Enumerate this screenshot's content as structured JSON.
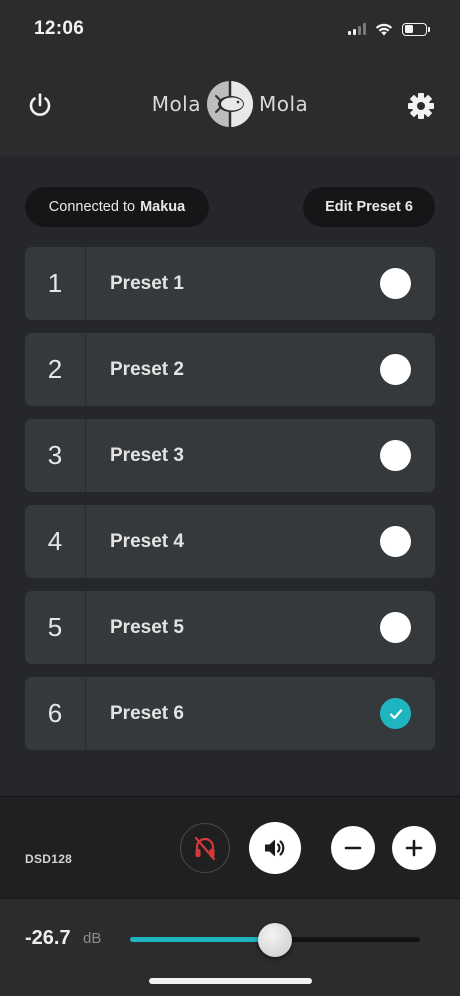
{
  "status_bar": {
    "time": "12:06",
    "signal_icon": "cellular-signal-icon",
    "wifi_icon": "wifi-icon",
    "battery_icon": "battery-icon",
    "battery_level": 0.4
  },
  "header": {
    "power_icon": "power-icon",
    "settings_icon": "gear-icon",
    "logo_left": "Mola",
    "logo_right": "Mola"
  },
  "connection": {
    "prefix": "Connected to",
    "device": "Makua"
  },
  "edit_preset_label": "Edit Preset 6",
  "presets": [
    {
      "number": "1",
      "name": "Preset 1",
      "selected": false
    },
    {
      "number": "2",
      "name": "Preset 2",
      "selected": false
    },
    {
      "number": "3",
      "name": "Preset 3",
      "selected": false
    },
    {
      "number": "4",
      "name": "Preset 4",
      "selected": false
    },
    {
      "number": "5",
      "name": "Preset 5",
      "selected": false
    },
    {
      "number": "6",
      "name": "Preset 6",
      "selected": true
    }
  ],
  "controls": {
    "format": "DSD128",
    "headphone_icon": "headphones-muted-icon",
    "speaker_icon": "speaker-icon",
    "minus_icon": "minus-icon",
    "plus_icon": "plus-icon"
  },
  "volume": {
    "value": "-26.7",
    "unit": "dB",
    "level": 0.5
  },
  "colors": {
    "accent": "#1eb5c0",
    "mute_red": "#d8373a",
    "background": "#2b2c2e",
    "card": "#35393c"
  }
}
